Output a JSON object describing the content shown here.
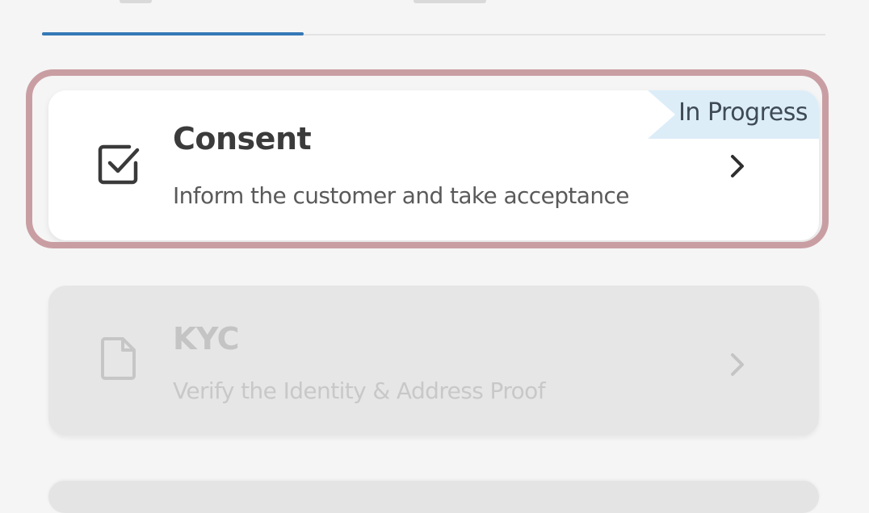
{
  "tabs": {
    "active_index": 0
  },
  "steps": [
    {
      "title": "Consent",
      "description": "Inform the customer and take acceptance",
      "status": "In Progress",
      "icon": "checkbox-icon",
      "state": "active"
    },
    {
      "title": "KYC",
      "description": "Verify the Identity & Address Proof",
      "icon": "document-icon",
      "state": "disabled"
    }
  ],
  "colors": {
    "tab_indicator": "#3578b5",
    "focus_ring": "#c99ea3",
    "status_ribbon": "#dcedf8",
    "active_card": "#ffffff",
    "disabled_card": "#e6e6e6"
  }
}
